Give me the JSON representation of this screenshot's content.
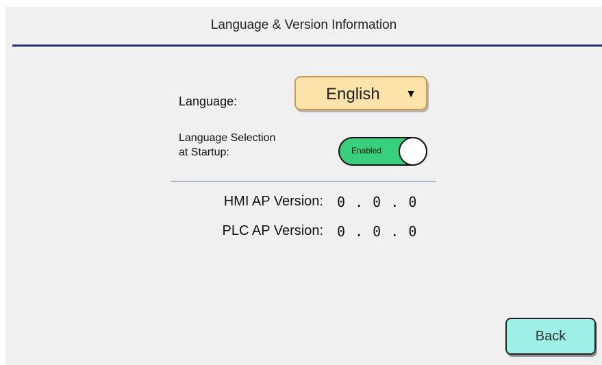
{
  "header": {
    "title": "Language & Version Information"
  },
  "language": {
    "label": "Language:",
    "selected": "English",
    "dropdown_icon": "triangle-down-icon"
  },
  "startup": {
    "label_line1": "Language Selection",
    "label_line2": "at Startup:",
    "toggle_state": "Enabled",
    "toggle_on": true
  },
  "versions": [
    {
      "label": "HMI AP Version:",
      "value": "0 . 0 . 0"
    },
    {
      "label": "PLC AP Version:",
      "value": "0 . 0 . 0"
    }
  ],
  "footer": {
    "back_label": "Back"
  },
  "colors": {
    "title_rule": "#22327a",
    "select_bg": "#fbe3a9",
    "toggle_on": "#38d07c",
    "back_button_bg": "#9cf0e6",
    "screen_bg": "#f0f0f0"
  }
}
